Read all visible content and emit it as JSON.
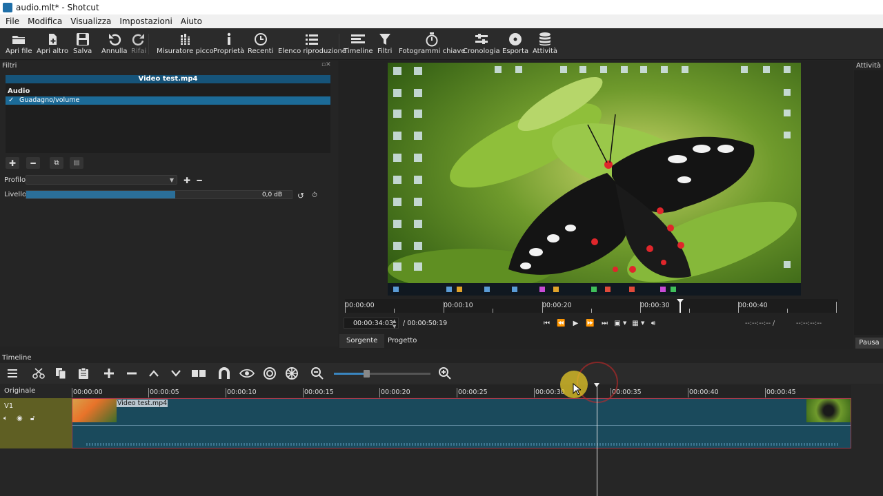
{
  "window": {
    "title": "audio.mlt* - Shotcut"
  },
  "menu": [
    "File",
    "Modifica",
    "Visualizza",
    "Impostazioni",
    "Aiuto"
  ],
  "toolbar": [
    {
      "label": "Apri file",
      "icon": "folder-open-icon"
    },
    {
      "label": "Apri altro",
      "icon": "open-other-icon"
    },
    {
      "label": "Salva",
      "icon": "save-icon"
    },
    {
      "label": "Annulla",
      "icon": "undo-icon"
    },
    {
      "label": "Rifai",
      "icon": "redo-icon"
    },
    {
      "label": "Misuratore picco",
      "icon": "peak-meter-icon"
    },
    {
      "label": "Proprietà",
      "icon": "info-icon"
    },
    {
      "label": "Recenti",
      "icon": "clock-icon"
    },
    {
      "label": "Elenco riproduzione",
      "icon": "playlist-icon"
    },
    {
      "label": "Timeline",
      "icon": "timeline-icon"
    },
    {
      "label": "Filtri",
      "icon": "filter-icon"
    },
    {
      "label": "Fotogrammi chiave",
      "icon": "stopwatch-icon"
    },
    {
      "label": "Cronologia",
      "icon": "history-icon"
    },
    {
      "label": "Esporta",
      "icon": "export-disc-icon"
    },
    {
      "label": "Attività",
      "icon": "database-icon"
    }
  ],
  "filters": {
    "panel_title": "Filtri",
    "clip_name": "Video test.mp4",
    "group": "Audio",
    "item": "Guadagno/volume",
    "profile_label": "Profilo",
    "profile_value": "",
    "level_label": "Livello",
    "level_value": "0,0 dB",
    "level_fraction": 0.56
  },
  "player": {
    "ruler_labels": [
      "00:00:00",
      "00:00:10",
      "00:00:20",
      "00:00:30",
      "00:00:40"
    ],
    "current_time": "00:00:34:03",
    "total_time": "/ 00:00:50:19",
    "in_point": "--:--:--:-- /",
    "out_point": "--:--:--:--",
    "tabs": [
      "Sorgente",
      "Progetto"
    ]
  },
  "activity": {
    "panel_title": "Attività",
    "pause_label": "Pausa"
  },
  "timeline": {
    "panel_title": "Timeline",
    "master_label": "Originale",
    "track_name": "V1",
    "clip_label": "Video test.mp4",
    "ruler_labels": [
      "00:00:00",
      "00:00:05",
      "00:00:10",
      "00:00:15",
      "00:00:20",
      "00:00:25",
      "00:00:30",
      "00:00:35",
      "00:00:40",
      "00:00:45"
    ]
  }
}
